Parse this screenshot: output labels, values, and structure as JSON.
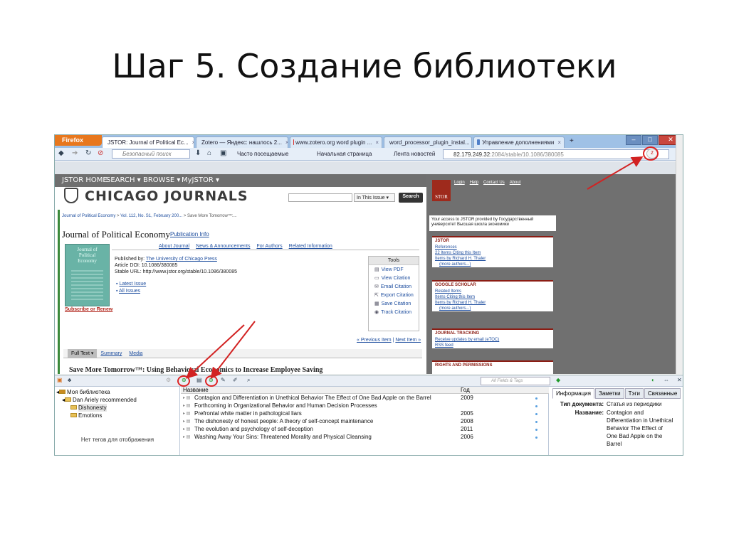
{
  "slide": {
    "title": "Шаг 5. Создание библиотеки"
  },
  "browser": {
    "app_button": "Firefox",
    "tabs": [
      {
        "label": "JSTOR: Journal of Political Ec...",
        "fav": "#b2281e",
        "active": true
      },
      {
        "label": "Zotero — Яндекс: нашлось 2...",
        "fav": "#d9302c",
        "active": false
      },
      {
        "label": "www.zotero.org word plugin ...",
        "fav": "#d9302c",
        "active": false
      },
      {
        "label": "word_processor_plugin_instal...",
        "fav": "#b2281e",
        "active": false
      },
      {
        "label": "Управление дополнениями",
        "fav": "#4f7fc9",
        "active": false
      }
    ],
    "new_tab": "+",
    "search_placeholder": "Безопасный поиск",
    "bookmarks": {
      "often": "Часто посещаемые",
      "home": "Начальная страница",
      "news": "Лента новостей"
    },
    "url_host": "82.179.249.32",
    "url_path": ":2084/stable/10.1086/380085"
  },
  "jstor": {
    "nav": [
      "JSTOR HOME",
      "SEARCH ▾",
      "BROWSE ▾",
      "MyJSTOR ▾"
    ],
    "logo": "CHICAGO JOURNALS",
    "in_issue": "In This Issue ▾",
    "search_button": "Search",
    "breadcrumb": {
      "journal": "Journal of Political Economy",
      "vol": "Vol. 112, No. S1, February 200...",
      "item": "Save More Tomorrow™:..."
    },
    "journal_title": "Journal of Political Economy",
    "pub_info": "Publication Info",
    "tabs": [
      "About Journal",
      "News & Announcements",
      "For Authors",
      "Related Information"
    ],
    "cover": [
      "Journal of",
      "Political",
      "Economy"
    ],
    "subscribe": "Subscribe or Renew",
    "published_by": "Published by:",
    "publisher": "The University of Chicago Press",
    "doi": "Article DOI: 10.1086/380085",
    "stable_url": "Stable URL: http://www.jstor.org/stable/10.1086/380085",
    "bullets": [
      "Latest Issue",
      "All Issues"
    ],
    "tools_header": "Tools",
    "tools": [
      "View PDF",
      "View Citation",
      "Email Citation",
      "Export Citation",
      "Save Citation",
      "Track Citation"
    ],
    "prev": "« Previous Item",
    "next": "Next Item »",
    "full_text": "Full Text ▾",
    "summary": "Summary",
    "media": "Media",
    "article_title": "Save More Tomorrow™: Using Behavioral Economics to Increase Employee Saving",
    "stor": "STOR",
    "top_links": [
      "Login",
      "Help",
      "Contact Us",
      "About"
    ],
    "access_text": "Your access to JSTOR provided by Государственный университет Высшая школа экономики",
    "box_jstor": {
      "h": "JSTOR",
      "links": [
        "References",
        "22 Items Citing this Item",
        "Items by Richard H. Thaler",
        "(more authors...)"
      ]
    },
    "box_google": {
      "h": "GOOGLE SCHOLAR",
      "links": [
        "Related Items",
        "Items Citing this Item",
        "Items by Richard H. Thaler",
        "(more authors...)"
      ]
    },
    "box_tracking": {
      "h": "JOURNAL TRACKING",
      "links": [
        "Receive updates by email (eTOC)",
        "RSS feed"
      ]
    },
    "box_rights": {
      "h": "RIGHTS AND PERMISSIONS"
    }
  },
  "zotero": {
    "search_placeholder": "All Fields & Tags",
    "tree": {
      "library": "Моя библиотека",
      "collection": "Dan Ariely recommended",
      "sub": [
        "Dishonesty",
        "Emotions"
      ]
    },
    "no_tags": "Нет тегов для отображения",
    "col_title": "Название",
    "col_year": "Год",
    "items": [
      {
        "title": "Contagion and Differentiation in Unethical Behavior The Effect of One Bad Apple on the Barrel",
        "year": "2009"
      },
      {
        "title": "Forthcoming in Organizational Behavior and Human Decision Processes",
        "year": ""
      },
      {
        "title": "Prefrontal white matter in pathological liars",
        "year": "2005"
      },
      {
        "title": "The dishonesty of honest people: A theory of self-concept maintenance",
        "year": "2008"
      },
      {
        "title": "The evolution and psychology of self-deception",
        "year": "2011"
      },
      {
        "title": "Washing Away Your Sins: Threatened Morality and Physical Cleansing",
        "year": "2006"
      }
    ],
    "info_tabs": [
      "Информация",
      "Заметки",
      "Тэги",
      "Связанные"
    ],
    "doc_type_label": "Тип документа:",
    "doc_type": "Статья из периодики",
    "title_label": "Название:",
    "title_value": "Contagion and Differentiation in Unethical Behavior The Effect of One Bad Apple on the Barrel"
  },
  "colors": {
    "annotation": "#d22222",
    "accent": "#8b1d14",
    "link": "#1d4d9e"
  }
}
